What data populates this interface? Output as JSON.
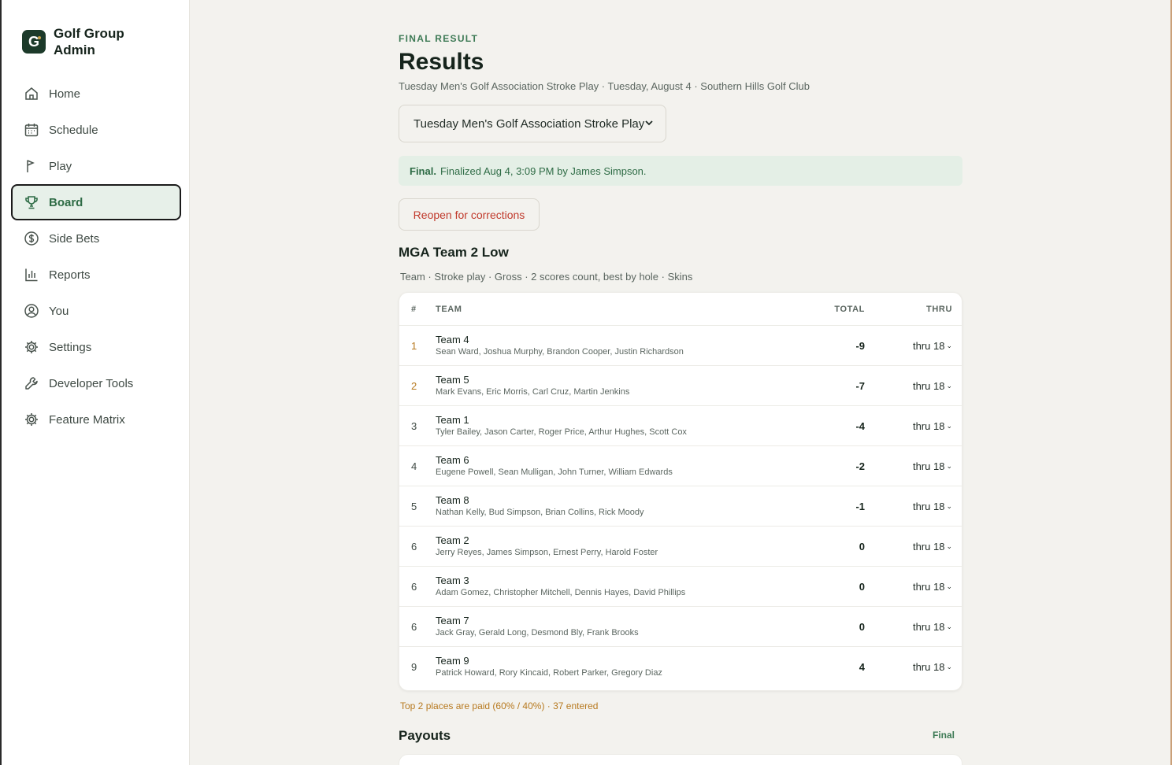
{
  "app": {
    "name": "Golf Group Admin",
    "logo_letter": "G"
  },
  "sidebar": {
    "items": [
      {
        "label": "Home",
        "icon": "home-icon"
      },
      {
        "label": "Schedule",
        "icon": "calendar-icon"
      },
      {
        "label": "Play",
        "icon": "flag-icon"
      },
      {
        "label": "Board",
        "icon": "trophy-icon",
        "active": true
      },
      {
        "label": "Side Bets",
        "icon": "dollar-icon"
      },
      {
        "label": "Reports",
        "icon": "chart-icon"
      },
      {
        "label": "You",
        "icon": "user-icon"
      },
      {
        "label": "Settings",
        "icon": "gear-icon"
      },
      {
        "label": "Developer Tools",
        "icon": "wrench-icon"
      },
      {
        "label": "Feature Matrix",
        "icon": "gear-icon"
      }
    ]
  },
  "header": {
    "eyebrow": "FINAL RESULT",
    "title": "Results",
    "subtitle": "Tuesday Men's Golf Association Stroke Play · Tuesday, August 4 · Southern Hills Golf Club"
  },
  "event_select": {
    "value": "Tuesday Men's Golf Association Stroke Play"
  },
  "final_banner": {
    "label": "Final.",
    "text": "Finalized Aug 4, 3:09 PM by James Simpson."
  },
  "reopen_button": "Reopen for corrections",
  "game": {
    "title": "MGA Team 2 Low",
    "meta": "Team · Stroke play · Gross · 2 scores count, best by hole · Skins",
    "columns": {
      "rank": "#",
      "team": "TEAM",
      "total": "TOTAL",
      "thru": "THRU"
    },
    "rows": [
      {
        "rank": "1",
        "team": "Team 4",
        "players": "Sean Ward, Joshua Murphy, Brandon Cooper, Justin Richardson",
        "total": "-9",
        "thru": "thru 18",
        "paid": true
      },
      {
        "rank": "2",
        "team": "Team 5",
        "players": "Mark Evans, Eric Morris, Carl Cruz, Martin Jenkins",
        "total": "-7",
        "thru": "thru 18",
        "paid": true
      },
      {
        "rank": "3",
        "team": "Team 1",
        "players": "Tyler Bailey, Jason Carter, Roger Price, Arthur Hughes, Scott Cox",
        "total": "-4",
        "thru": "thru 18",
        "paid": false
      },
      {
        "rank": "4",
        "team": "Team 6",
        "players": "Eugene Powell, Sean Mulligan, John Turner, William Edwards",
        "total": "-2",
        "thru": "thru 18",
        "paid": false
      },
      {
        "rank": "5",
        "team": "Team 8",
        "players": "Nathan Kelly, Bud Simpson, Brian Collins, Rick Moody",
        "total": "-1",
        "thru": "thru 18",
        "paid": false
      },
      {
        "rank": "6",
        "team": "Team 2",
        "players": "Jerry Reyes, James Simpson, Ernest Perry, Harold Foster",
        "total": "0",
        "thru": "thru 18",
        "paid": false
      },
      {
        "rank": "6",
        "team": "Team 3",
        "players": "Adam Gomez, Christopher Mitchell, Dennis Hayes, David Phillips",
        "total": "0",
        "thru": "thru 18",
        "paid": false
      },
      {
        "rank": "6",
        "team": "Team 7",
        "players": "Jack Gray, Gerald Long, Desmond Bly, Frank Brooks",
        "total": "0",
        "thru": "thru 18",
        "paid": false
      },
      {
        "rank": "9",
        "team": "Team 9",
        "players": "Patrick Howard, Rory Kincaid, Robert Parker, Gregory Diaz",
        "total": "4",
        "thru": "thru 18",
        "paid": false
      }
    ],
    "paid_note": "Top 2 places are paid (60% / 40%) · 37 entered"
  },
  "payouts": {
    "title": "Payouts",
    "status": "Final"
  },
  "colors": {
    "accent": "#2e6b45",
    "paid": "#b7791f",
    "danger": "#c0392b",
    "brand": "#1c3a2a"
  }
}
